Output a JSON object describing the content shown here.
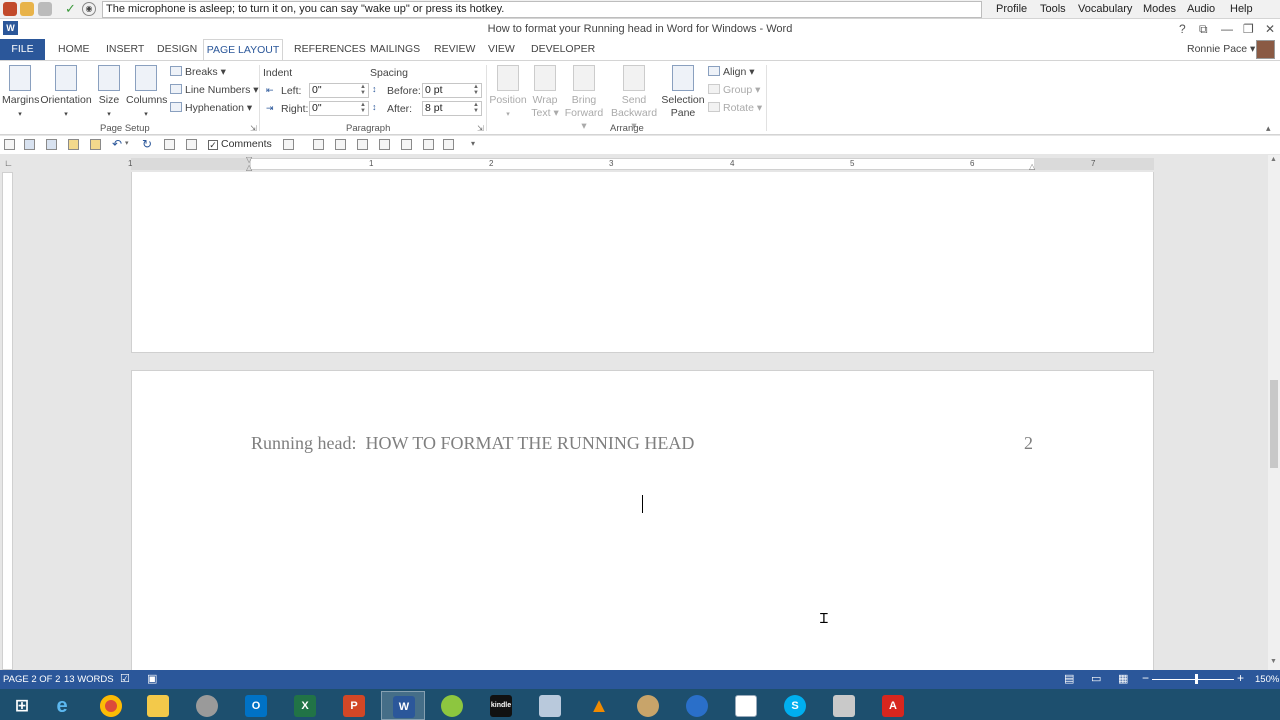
{
  "dragon": {
    "message": "The microphone is asleep; to turn it on, you can say \"wake up\" or press its hotkey.",
    "menus": [
      "Profile",
      "Tools",
      "Vocabulary",
      "Modes",
      "Audio",
      "Help"
    ]
  },
  "window": {
    "title": "How to format your Running head in Word for Windows - Word",
    "help": "?",
    "restore_ribbon": "⧉",
    "minimize": "—",
    "maximize": "❐",
    "close": "✕"
  },
  "tabs": {
    "file": "FILE",
    "items": [
      "HOME",
      "INSERT",
      "DESIGN",
      "PAGE LAYOUT",
      "REFERENCES",
      "MAILINGS",
      "REVIEW",
      "VIEW",
      "DEVELOPER"
    ],
    "active": "PAGE LAYOUT",
    "user": "Ronnie Pace ▾"
  },
  "ribbon": {
    "page_setup": {
      "margins": "Margins",
      "orientation": "Orientation",
      "size": "Size",
      "columns": "Columns",
      "breaks": "Breaks ▾",
      "line_numbers": "Line Numbers ▾",
      "hyphenation": "Hyphenation ▾",
      "label": "Page Setup"
    },
    "paragraph": {
      "indent_label": "Indent",
      "spacing_label": "Spacing",
      "left_label": "Left:",
      "left_value": "0\"",
      "right_label": "Right:",
      "right_value": "0\"",
      "before_label": "Before:",
      "before_value": "0 pt",
      "after_label": "After:",
      "after_value": "8 pt",
      "label": "Paragraph"
    },
    "arrange": {
      "position": "Position",
      "wrap_text": [
        "Wrap",
        "Text ▾"
      ],
      "bring_forward": [
        "Bring",
        "Forward ▾"
      ],
      "send_backward": [
        "Send",
        "Backward ▾"
      ],
      "selection_pane": [
        "Selection",
        "Pane"
      ],
      "align": "Align ▾",
      "group": "Group ▾",
      "rotate": "Rotate ▾",
      "label": "Arrange"
    }
  },
  "qat": {
    "comments": "Comments"
  },
  "ruler": {
    "numbers": [
      "1",
      "1",
      "2",
      "3",
      "4",
      "5",
      "6",
      "7"
    ]
  },
  "document": {
    "running_head": "Running head:  HOW TO FORMAT THE RUNNING HEAD",
    "page_number": "2"
  },
  "status": {
    "page": "PAGE 2 OF 2",
    "words": "13 WORDS",
    "zoom_minus": "−",
    "zoom_plus": "+",
    "zoom": "150%",
    "zoom_level_percent": 150
  },
  "taskbar": {
    "apps": [
      "start",
      "internet-explorer",
      "chrome",
      "file-explorer",
      "dragon",
      "outlook",
      "excel",
      "powerpoint",
      "word",
      "dragon-green",
      "kindle",
      "calculator",
      "vlc",
      "gimp",
      "google-earth",
      "window",
      "skype",
      "tool",
      "acrobat"
    ],
    "active": "word"
  }
}
